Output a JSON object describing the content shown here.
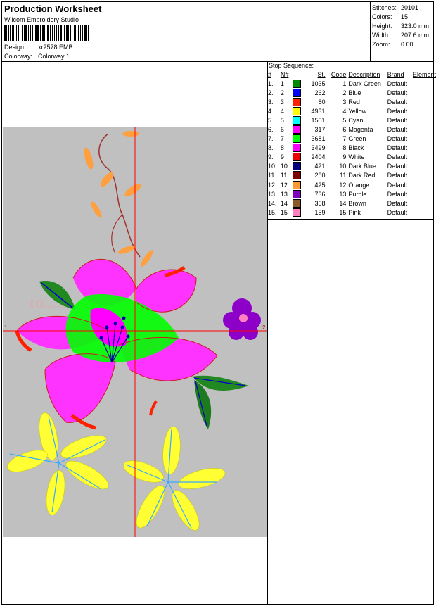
{
  "header": {
    "title": "Production Worksheet",
    "company": "Wilcom  Embroidery Studio",
    "design_label": "Design:",
    "design_value": "xr2578.EMB",
    "colorway_label": "Colorway:",
    "colorway_value": "Colorway 1"
  },
  "stats": [
    {
      "label": "Stitches:",
      "value": "20101"
    },
    {
      "label": "Colors:",
      "value": "15"
    },
    {
      "label": "Height:",
      "value": "323.0 mm"
    },
    {
      "label": "Width:",
      "value": "207.6 mm"
    },
    {
      "label": "Zoom:",
      "value": "0.60"
    }
  ],
  "stop_sequence": {
    "title": "Stop Sequence:",
    "columns": [
      "#",
      "N#",
      "St.",
      "Code",
      "Description",
      "Brand",
      "Element"
    ],
    "rows": [
      {
        "idx": "1.",
        "n": "1",
        "color": "#008800",
        "st": "1035",
        "code": "1",
        "desc": "Dark Green",
        "brand": "Default"
      },
      {
        "idx": "2.",
        "n": "2",
        "color": "#0000ff",
        "st": "262",
        "code": "2",
        "desc": "Blue",
        "brand": "Default"
      },
      {
        "idx": "3.",
        "n": "3",
        "color": "#ff2000",
        "st": "80",
        "code": "3",
        "desc": "Red",
        "brand": "Default"
      },
      {
        "idx": "4.",
        "n": "4",
        "color": "#ffff00",
        "st": "4931",
        "code": "4",
        "desc": "Yellow",
        "brand": "Default"
      },
      {
        "idx": "5.",
        "n": "5",
        "color": "#00ffff",
        "st": "1501",
        "code": "5",
        "desc": "Cyan",
        "brand": "Default"
      },
      {
        "idx": "6.",
        "n": "6",
        "color": "#ff00ff",
        "st": "317",
        "code": "6",
        "desc": "Magenta",
        "brand": "Default"
      },
      {
        "idx": "7.",
        "n": "7",
        "color": "#00ff00",
        "st": "3681",
        "code": "7",
        "desc": "Green",
        "brand": "Default"
      },
      {
        "idx": "8.",
        "n": "8",
        "color": "#ff00ff",
        "st": "3499",
        "code": "8",
        "desc": "Black",
        "brand": "Default"
      },
      {
        "idx": "9.",
        "n": "9",
        "color": "#ee0000",
        "st": "2404",
        "code": "9",
        "desc": "White",
        "brand": "Default"
      },
      {
        "idx": "10.",
        "n": "10",
        "color": "#000080",
        "st": "421",
        "code": "10",
        "desc": "Dark Blue",
        "brand": "Default"
      },
      {
        "idx": "11.",
        "n": "11",
        "color": "#800000",
        "st": "280",
        "code": "11",
        "desc": "Dark Red",
        "brand": "Default"
      },
      {
        "idx": "12.",
        "n": "12",
        "color": "#ff9933",
        "st": "425",
        "code": "12",
        "desc": "Orange",
        "brand": "Default"
      },
      {
        "idx": "13.",
        "n": "13",
        "color": "#8000c0",
        "st": "736",
        "code": "13",
        "desc": "Purple",
        "brand": "Default"
      },
      {
        "idx": "14.",
        "n": "14",
        "color": "#8b5a2b",
        "st": "368",
        "code": "14",
        "desc": "Brown",
        "brand": "Default"
      },
      {
        "idx": "15.",
        "n": "15",
        "color": "#ff7fbf",
        "st": "159",
        "code": "15",
        "desc": "Pink",
        "brand": "Default"
      }
    ]
  },
  "preview": {
    "background": "#c0c0c0",
    "crosshair_color": "#ff0000",
    "axis_label_left": "1",
    "axis_label_right": "2",
    "watermark": "to..........designs.com"
  }
}
